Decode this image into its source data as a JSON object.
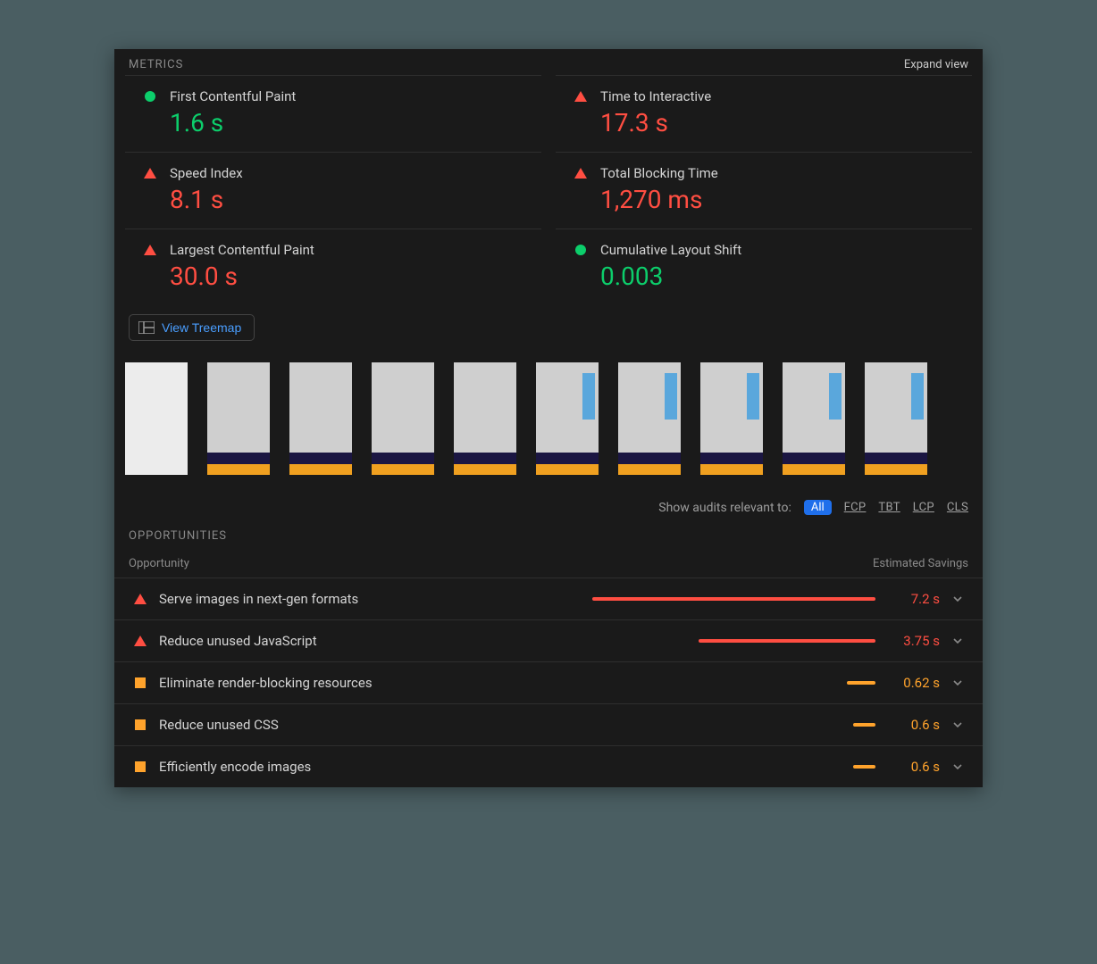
{
  "sections": {
    "metrics_title": "METRICS",
    "expand_view": "Expand view",
    "opportunities_title": "OPPORTUNITIES"
  },
  "metrics": [
    {
      "label": "First Contentful Paint",
      "value": "1.6 s",
      "status": "good"
    },
    {
      "label": "Time to Interactive",
      "value": "17.3 s",
      "status": "poor"
    },
    {
      "label": "Speed Index",
      "value": "8.1 s",
      "status": "poor"
    },
    {
      "label": "Total Blocking Time",
      "value": "1,270 ms",
      "status": "poor"
    },
    {
      "label": "Largest Contentful Paint",
      "value": "30.0 s",
      "status": "poor"
    },
    {
      "label": "Cumulative Layout Shift",
      "value": "0.003",
      "status": "good"
    }
  ],
  "treemap": {
    "label": "View Treemap"
  },
  "filmstrip": [
    {
      "kind": "blank"
    },
    {
      "kind": "partial"
    },
    {
      "kind": "partial"
    },
    {
      "kind": "partial"
    },
    {
      "kind": "partial"
    },
    {
      "kind": "withsky"
    },
    {
      "kind": "withsky"
    },
    {
      "kind": "withsky"
    },
    {
      "kind": "withsky"
    },
    {
      "kind": "withsky"
    }
  ],
  "audit_filter": {
    "label": "Show audits relevant to:",
    "active": "All",
    "options": [
      "FCP",
      "TBT",
      "LCP",
      "CLS"
    ]
  },
  "opportunities_head": {
    "left": "Opportunity",
    "right": "Estimated Savings"
  },
  "opportunities": [
    {
      "label": "Serve images in next-gen formats",
      "savings": "7.2 s",
      "status": "poor",
      "bar_pct": 88
    },
    {
      "label": "Reduce unused JavaScript",
      "savings": "3.75 s",
      "status": "poor",
      "bar_pct": 55
    },
    {
      "label": "Eliminate render-blocking resources",
      "savings": "0.62 s",
      "status": "average",
      "bar_pct": 9
    },
    {
      "label": "Reduce unused CSS",
      "savings": "0.6 s",
      "status": "average",
      "bar_pct": 7
    },
    {
      "label": "Efficiently encode images",
      "savings": "0.6 s",
      "status": "average",
      "bar_pct": 7
    }
  ],
  "colors": {
    "good": "#0cce6b",
    "average": "#ffa32c",
    "poor": "#ff4e42"
  }
}
